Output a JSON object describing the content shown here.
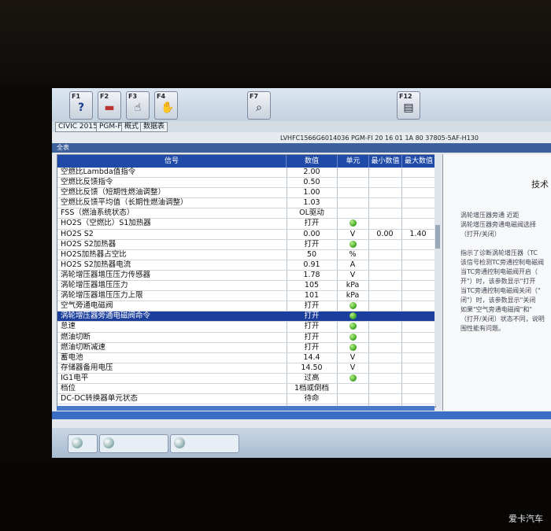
{
  "toolbar": {
    "keys": [
      {
        "label": "F1",
        "icon": "help-icon",
        "glyph": "?"
      },
      {
        "label": "F2",
        "icon": "car-icon",
        "glyph": "🚗"
      },
      {
        "label": "F3",
        "icon": "hand-select-icon",
        "glyph": "☝"
      },
      {
        "label": "F4",
        "icon": "hand-tool-icon",
        "glyph": "✋"
      },
      {
        "label": "F7",
        "icon": "magnifier-icon",
        "glyph": "🔍"
      },
      {
        "label": "F12",
        "icon": "print-icon",
        "glyph": "🖶"
      }
    ]
  },
  "breadcrumb": [
    "CIVIC 2015",
    "PGM-FI",
    "概式",
    "数据表"
  ],
  "vin_line": "LVHFC1566G6014036  PGM-FI 20 16 01 1A 80  37805-5AF-H130",
  "panel_title": "全表",
  "table": {
    "headers": [
      "信号",
      "数值",
      "单元",
      "最小数值",
      "最大数值"
    ],
    "header_value_partial": "数值",
    "rows": [
      {
        "signal": "空燃比Lambda值指令",
        "value": "2.00",
        "unit": "",
        "min": "",
        "max": ""
      },
      {
        "signal": "空燃比反馈指令",
        "value": "0.50",
        "unit": "",
        "min": "",
        "max": ""
      },
      {
        "signal": "空燃比反馈（短期性燃油调整）",
        "value": "1.00",
        "unit": "",
        "min": "",
        "max": ""
      },
      {
        "signal": "空燃比反馈平均值（长期性燃油调整）",
        "value": "1.03",
        "unit": "",
        "min": "",
        "max": ""
      },
      {
        "signal": "FSS（燃油系统状态）",
        "value": "OL驱动",
        "unit": "",
        "min": "",
        "max": ""
      },
      {
        "signal": "HO2S（空燃比）S1加热器",
        "value": "打开",
        "unit": "dot",
        "min": "",
        "max": ""
      },
      {
        "signal": "HO2S S2",
        "value": "0.00",
        "unit": "V",
        "min": "0.00",
        "max": "1.40"
      },
      {
        "signal": "HO2S S2加热器",
        "value": "打开",
        "unit": "dot",
        "min": "",
        "max": ""
      },
      {
        "signal": "HO2S加热器占空比",
        "value": "50",
        "unit": "%",
        "min": "",
        "max": ""
      },
      {
        "signal": "HO2S S2加热器电流",
        "value": "0.91",
        "unit": "A",
        "min": "",
        "max": ""
      },
      {
        "signal": "涡轮增压器增压压力传感器",
        "value": "1.78",
        "unit": "V",
        "min": "",
        "max": ""
      },
      {
        "signal": "涡轮增压器增压压力",
        "value": "105",
        "unit": "kPa",
        "min": "",
        "max": ""
      },
      {
        "signal": "涡轮增压器增压压力上限",
        "value": "101",
        "unit": "kPa",
        "min": "",
        "max": ""
      },
      {
        "signal": "空气旁通电磁阀",
        "value": "打开",
        "unit": "dot",
        "min": "",
        "max": ""
      },
      {
        "signal": "涡轮增压器旁通电磁阀命令",
        "value": "打开",
        "unit": "dot",
        "min": "",
        "max": "",
        "selected": true
      },
      {
        "signal": "怠速",
        "value": "打开",
        "unit": "dot",
        "min": "",
        "max": ""
      },
      {
        "signal": "燃油切断",
        "value": "打开",
        "unit": "dot",
        "min": "",
        "max": ""
      },
      {
        "signal": "燃油切断减速",
        "value": "打开",
        "unit": "dot",
        "min": "",
        "max": ""
      },
      {
        "signal": "蓄电池",
        "value": "14.4",
        "unit": "V",
        "min": "",
        "max": ""
      },
      {
        "signal": "存储器备用电压",
        "value": "14.50",
        "unit": "V",
        "min": "",
        "max": ""
      },
      {
        "signal": "IG1电平",
        "value": "过高",
        "unit": "dot",
        "min": "",
        "max": ""
      },
      {
        "signal": "档位",
        "value": "1档或倒档",
        "unit": "",
        "min": "",
        "max": ""
      },
      {
        "signal": "DC-DC转换器单元状态",
        "value": "待命",
        "unit": "",
        "min": "",
        "max": ""
      }
    ]
  },
  "help_panel": {
    "title": "技术",
    "lines": [
      "涡轮增压器旁通 近距",
      "涡轮增压器旁通电磁阀选择",
      "（打开/关闭）",
      "",
      "指示了诊断涡轮增压器（TC",
      "该信号检测TC旁通控制电磁阀",
      "当TC旁通控制电磁阀开启（",
      "开\"）时，该参数显示\"打开",
      "当TC旁通控制电磁阀关闭（\"",
      "闭\"）时，该参数显示\"关闭",
      "如果\"空气旁通电磁阀\"和\"",
      "（打开/关闭）状态不同，说明",
      "围性能有问题。"
    ]
  },
  "watermark": "爱卡汽车"
}
